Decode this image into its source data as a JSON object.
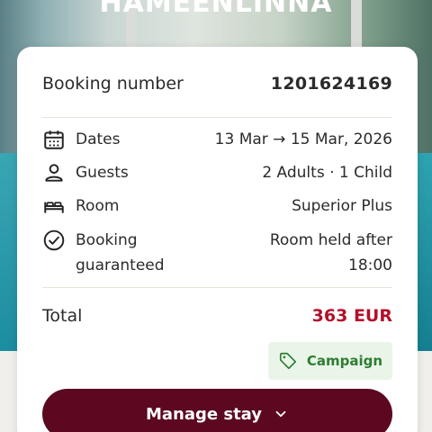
{
  "hero": {
    "title": "HAMEENLINNA"
  },
  "booking": {
    "label": "Booking number",
    "number": "1201624169"
  },
  "details": [
    {
      "icon": "calendar-icon",
      "label": "Dates",
      "value": "13 Mar → 15 Mar, 2026"
    },
    {
      "icon": "person-icon",
      "label": "Guests",
      "value": "2 Adults · 1 Child"
    },
    {
      "icon": "bed-icon",
      "label": "Room",
      "value": "Superior Plus"
    },
    {
      "icon": "check-circle-icon",
      "label_line1": "Booking",
      "label_line2": "guaranteed",
      "value_line1": "Room held after",
      "value_line2": "18:00"
    }
  ],
  "total": {
    "label": "Total",
    "price": "363 EUR"
  },
  "campaign": {
    "label": "Campaign"
  },
  "manage": {
    "label": "Manage stay"
  },
  "colors": {
    "primary": "#5b0820",
    "price": "#b3102a",
    "campaign_bg": "#eaf5e9",
    "campaign_text": "#2e7d32"
  }
}
